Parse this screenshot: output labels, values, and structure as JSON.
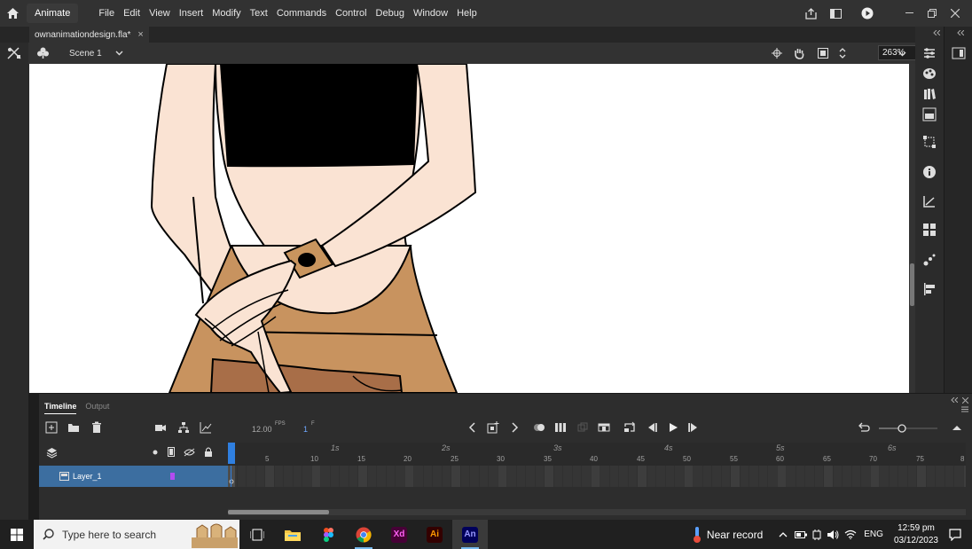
{
  "menubar": {
    "app_label": "Animate",
    "menus": [
      "File",
      "Edit",
      "View",
      "Insert",
      "Modify",
      "Text",
      "Commands",
      "Control",
      "Debug",
      "Window",
      "Help"
    ]
  },
  "document": {
    "tab_title": "ownanimationdesign.fla*",
    "close_glyph": "×"
  },
  "scene": {
    "name": "Scene 1",
    "zoom": "263%"
  },
  "timeline": {
    "tabs": [
      "Timeline",
      "Output"
    ],
    "fps": "12.00",
    "fps_unit": "FPS",
    "current_frame": "1",
    "frame_unit": "F",
    "layer_name": "Layer_1",
    "seconds": [
      "1s",
      "2s",
      "3s",
      "4s",
      "5s",
      "6s"
    ],
    "frame_marks": [
      "5",
      "10",
      "15",
      "20",
      "25",
      "30",
      "35",
      "40",
      "45",
      "50",
      "55",
      "60",
      "65",
      "70",
      "75",
      "8"
    ]
  },
  "taskbar": {
    "search_placeholder": "Type here to search",
    "apps": [
      "task-view",
      "file-explorer",
      "figma",
      "chrome",
      "adobe-xd",
      "illustrator",
      "animate"
    ],
    "xd_label": "Xd",
    "ai_label": "Ai",
    "an_label": "An",
    "weather": "Near record",
    "language": "ENG",
    "time": "12:59 pm",
    "date": "03/12/2023"
  },
  "colors": {
    "skin": "#fae3d3",
    "pants": "#c8935f",
    "belt": "#a86e48",
    "watch": "#c9955e",
    "top": "#000000",
    "accent": "#2f7fe0",
    "layer_row": "#3c6ea0"
  }
}
